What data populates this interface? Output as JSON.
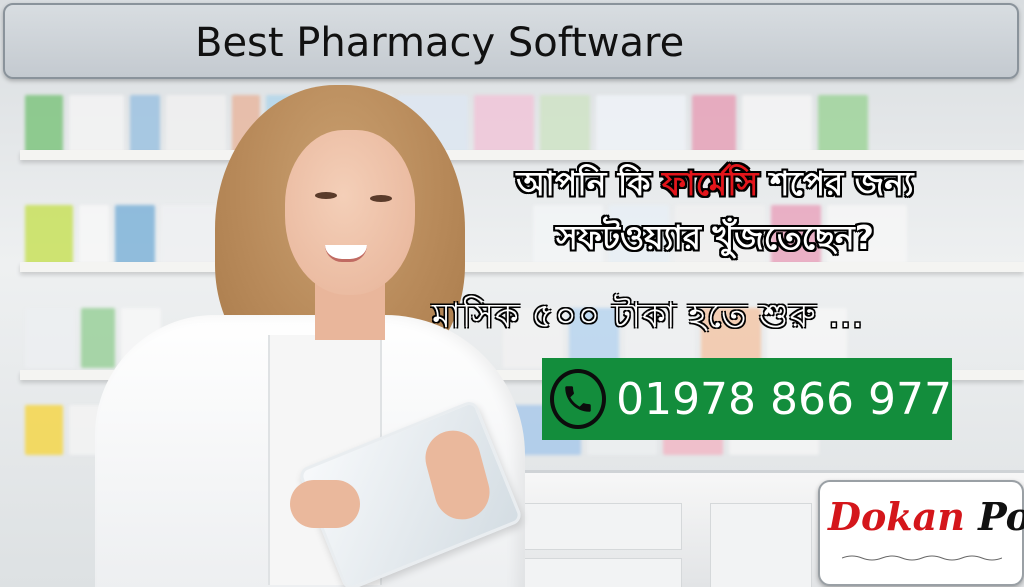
{
  "header": {
    "title": "Best Pharmacy Software"
  },
  "headline": {
    "line1_before": "আপনি কি ",
    "line1_highlight": "ফার্মেসি",
    "line1_after": " শপের জন্য",
    "line2": "সফটওয়্যার খুঁজতেছেন?"
  },
  "price_text": "মাসিক ৫০০ টাকা হতে শুরু ...",
  "contact": {
    "phone_icon": "phone-icon",
    "number": "01978 866 977"
  },
  "logo": {
    "part1": "Dokan",
    "part2": "Pos"
  },
  "colors": {
    "accent_red": "#e3151b",
    "phone_box_green": "#138d3c",
    "header_bg": "#c4cad0"
  }
}
